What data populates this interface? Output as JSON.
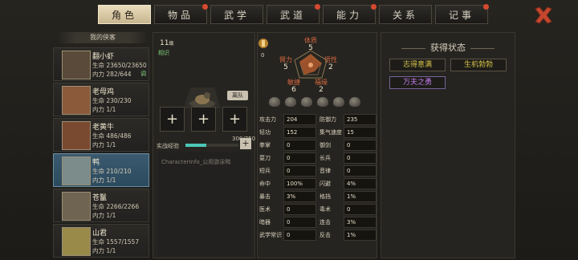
{
  "tabs": [
    {
      "label": "角色",
      "active": true,
      "badge": false
    },
    {
      "label": "物品",
      "active": false,
      "badge": true
    },
    {
      "label": "武学",
      "active": false,
      "badge": false
    },
    {
      "label": "武道",
      "active": false,
      "badge": true
    },
    {
      "label": "能力",
      "active": false,
      "badge": true
    },
    {
      "label": "关系",
      "active": false,
      "badge": false
    },
    {
      "label": "记事",
      "active": false,
      "badge": true
    }
  ],
  "roster": {
    "title": "我的侠客",
    "members": [
      {
        "name": "翻小虾",
        "hp": "生命 23650/23650",
        "mp": "内力 282/644",
        "tag": "调",
        "selected": false
      },
      {
        "name": "老母鸡",
        "hp": "生命 230/230",
        "mp": "内力 1/1",
        "tag": "",
        "selected": false
      },
      {
        "name": "老黄牛",
        "hp": "生命 486/486",
        "mp": "内力 1/1",
        "tag": "",
        "selected": false
      },
      {
        "name": "鸭",
        "hp": "生命 210/210",
        "mp": "内力 1/1",
        "tag": "",
        "selected": true
      },
      {
        "name": "苍鬣",
        "hp": "生命 2266/2266",
        "mp": "内力 1/1",
        "tag": "",
        "selected": false
      },
      {
        "name": "山君",
        "hp": "生命 1557/1557",
        "mp": "内力 1/1",
        "tag": "",
        "selected": false
      }
    ]
  },
  "character": {
    "level_num": "11",
    "level_unit": "级",
    "level_sub": "相识",
    "leave_button": "离队",
    "slot_symbol": "+",
    "exp_label": "实战经验",
    "exp_value": "300/750",
    "exp_fraction": 0.4,
    "exp_plus": "+",
    "description": "CharacterInfo_公用游泳鸭"
  },
  "attributes": {
    "fate_value": "0",
    "radar": [
      {
        "label": "体质",
        "value": "5"
      },
      {
        "label": "悟性",
        "value": "2"
      },
      {
        "label": "福缘",
        "value": "2"
      },
      {
        "label": "敏捷",
        "value": "6"
      },
      {
        "label": "臂力",
        "value": "5"
      }
    ],
    "stats_left": [
      {
        "k": "攻击力",
        "v": "204"
      },
      {
        "k": "轻功",
        "v": "152"
      },
      {
        "k": "拳掌",
        "v": "0"
      },
      {
        "k": "耍刀",
        "v": "0"
      },
      {
        "k": "短兵",
        "v": "0"
      },
      {
        "k": "命中",
        "v": "100%"
      },
      {
        "k": "暴击",
        "v": "3%"
      },
      {
        "k": "医术",
        "v": "0"
      },
      {
        "k": "暗器",
        "v": "0"
      },
      {
        "k": "武学常识",
        "v": "0"
      }
    ],
    "stats_right": [
      {
        "k": "防御力",
        "v": "235"
      },
      {
        "k": "集气速度",
        "v": "15"
      },
      {
        "k": "御剑",
        "v": "0"
      },
      {
        "k": "长兵",
        "v": "0"
      },
      {
        "k": "音律",
        "v": "0"
      },
      {
        "k": "闪避",
        "v": "4%"
      },
      {
        "k": "格挡",
        "v": "1%"
      },
      {
        "k": "毒术",
        "v": "0"
      },
      {
        "k": "连击",
        "v": "3%"
      },
      {
        "k": "反击",
        "v": "1%"
      }
    ]
  },
  "status": {
    "title": "获得状态",
    "items": [
      {
        "label": "志得意满",
        "color": "#d6c24a"
      },
      {
        "label": "生机勃勃",
        "color": "#d6c24a"
      },
      {
        "label": "万夫之勇",
        "color": "#c67df0"
      }
    ]
  },
  "colors": {
    "accent_tab": "#e9dcbc",
    "selected_card": "#3b5a6f",
    "close_icon": "#c6472e",
    "exp_bar": "#4cc7b7",
    "radar_label": "#d3673e"
  }
}
